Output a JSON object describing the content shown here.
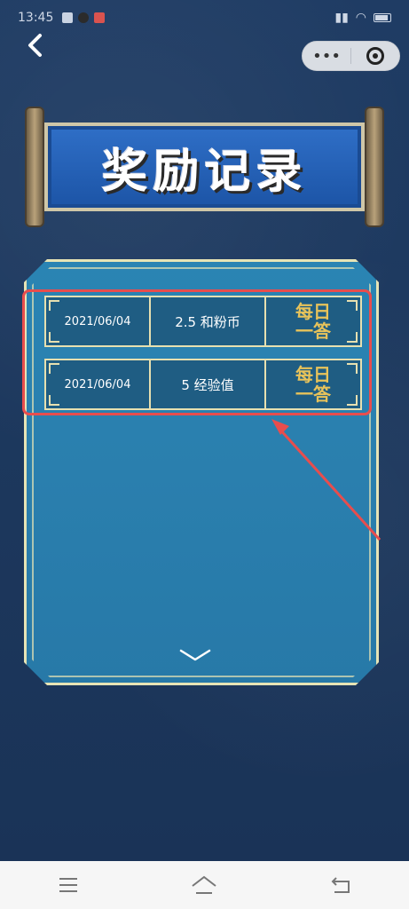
{
  "status_bar": {
    "time": "13:45"
  },
  "header": {
    "back_icon": "chevron-left-icon",
    "capsule_more": "•••",
    "capsule_target_icon": "target-icon"
  },
  "banner": {
    "title": "奖励记录"
  },
  "records": [
    {
      "date": "2021/06/04",
      "amount": "2.5 和粉币",
      "source_line1": "每日",
      "source_line2": "一答"
    },
    {
      "date": "2021/06/04",
      "amount": "5 经验值",
      "source_line1": "每日",
      "source_line2": "一答"
    }
  ],
  "colors": {
    "background": "#1e3a5f",
    "panel": "#2a84b3",
    "accent_gold": "#e8c35a",
    "highlight_red": "#e84d4d"
  }
}
